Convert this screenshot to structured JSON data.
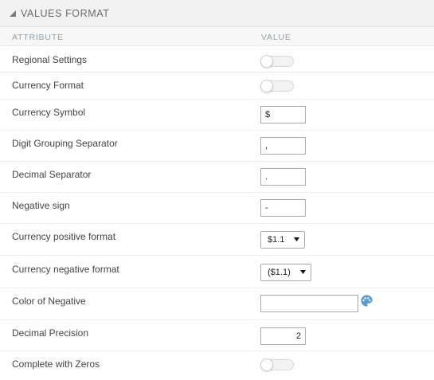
{
  "panel": {
    "title": "VALUES FORMAT",
    "header_bg": "#f2f2f2",
    "collapse_icon": "triangle-collapse-icon"
  },
  "columns": {
    "attribute": "ATTRIBUTE",
    "value": "VALUE"
  },
  "rows": {
    "regional_settings": {
      "label": "Regional Settings",
      "enabled": false
    },
    "currency_format": {
      "label": "Currency Format",
      "enabled": false
    },
    "currency_symbol": {
      "label": "Currency Symbol",
      "value": "$"
    },
    "digit_grouping": {
      "label": "Digit Grouping Separator",
      "value": ","
    },
    "decimal_separator": {
      "label": "Decimal Separator",
      "value": "."
    },
    "negative_sign": {
      "label": "Negative sign",
      "value": "-"
    },
    "currency_positive": {
      "label": "Currency positive format",
      "selected": "$1.1"
    },
    "currency_negative": {
      "label": "Currency negative format",
      "selected": "($1.1)"
    },
    "color_negative": {
      "label": "Color of Negative",
      "value": "",
      "icon": "palette-icon"
    },
    "decimal_precision": {
      "label": "Decimal Precision",
      "value": "2"
    },
    "complete_zeros": {
      "label": "Complete with Zeros",
      "enabled": false
    }
  }
}
